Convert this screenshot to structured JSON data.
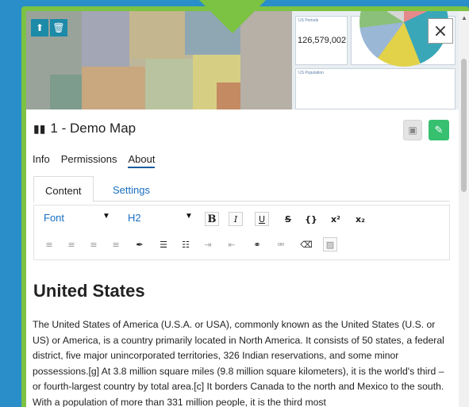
{
  "hero": {
    "stat_value": "126,579,002",
    "card1_title": "US Periods",
    "card2_title": "US Population",
    "close_glyph": "×"
  },
  "title": {
    "icon": "map-icon",
    "text": "1 - Demo Map"
  },
  "nav_tabs": [
    "Info",
    "Permissions",
    "About"
  ],
  "active_nav_tab": "About",
  "sub_tabs": [
    "Content",
    "Settings"
  ],
  "active_sub_tab": "Content",
  "editor": {
    "font_select": "Font",
    "size_select": "H2",
    "buttons_row1": [
      "B",
      "I",
      "U",
      "S",
      "{}",
      "x²",
      "x₂"
    ]
  },
  "content": {
    "heading": "United States",
    "paragraph": "The United States of America (U.S.A. or USA), commonly known as the United States (U.S. or US) or America, is a country primarily located in North America. It consists of 50 states, a federal district, five major unincorporated territories, 326 Indian reservations, and some minor possessions.[g] At 3.8 million square miles (9.8 million square kilometers), it is the world's third – or fourth-largest country by total area.[c] It borders Canada to the north and Mexico to the south. With a population of more than 331 million people, it is the third most"
  },
  "colors": {
    "accent_green": "#7cc243",
    "background_blue": "#2a8fc9",
    "link_blue": "#1a6ec2",
    "edit_green": "#37c06f"
  }
}
